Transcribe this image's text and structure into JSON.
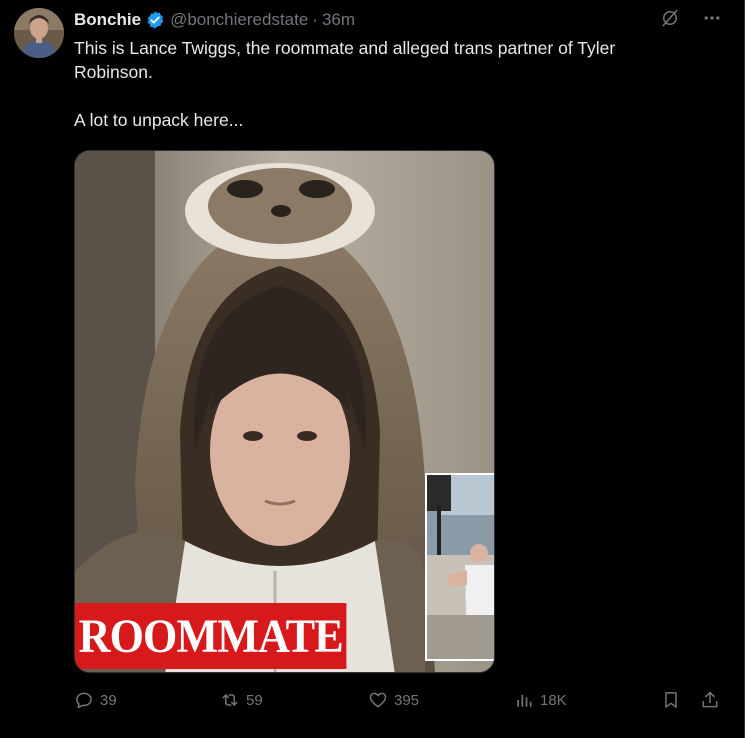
{
  "tweet": {
    "author_name": "Bonchie",
    "handle": "@bonchieredstate",
    "separator": "·",
    "time": "36m",
    "text_line1": "This is Lance Twiggs, the roommate and alleged trans partner of Tyler Robinson.",
    "text_line2": "A lot to unpack here...",
    "media_caption": "ROOMMATE",
    "replies": "39",
    "reposts": "59",
    "likes": "395",
    "views": "18K"
  },
  "colors": {
    "background": "#000000",
    "text": "#e7e9ea",
    "muted": "#71767b",
    "verified": "#1d9bf0",
    "caption_bg": "#d7191b"
  },
  "icons": [
    "grok-icon",
    "more-icon",
    "reply-icon",
    "repost-icon",
    "like-icon",
    "views-icon",
    "bookmark-icon",
    "share-icon",
    "verified-badge-icon"
  ]
}
